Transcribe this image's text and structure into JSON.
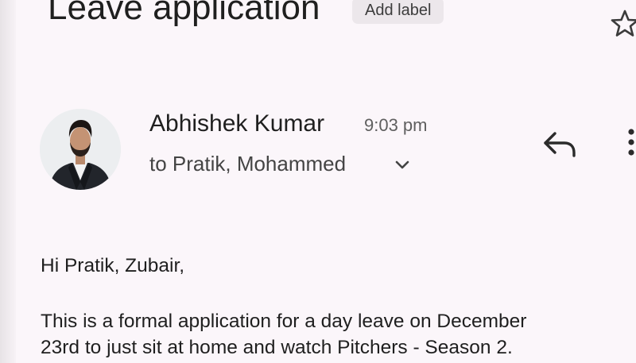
{
  "email": {
    "subject": "Leave application",
    "add_label": "Add label",
    "sender_name": "Abhishek Kumar",
    "time": "9:03 pm",
    "recipients": "to Pratik, Mohammed",
    "greeting": "Hi Pratik, Zubair,",
    "body_line1": "This is a formal application for a day leave on December",
    "body_line2": "23rd to just sit at home and watch Pitchers - Season 2."
  },
  "icons": {
    "star": "star-icon",
    "expand": "chevron-down-icon",
    "reply": "reply-icon",
    "more": "more-vert-icon"
  }
}
